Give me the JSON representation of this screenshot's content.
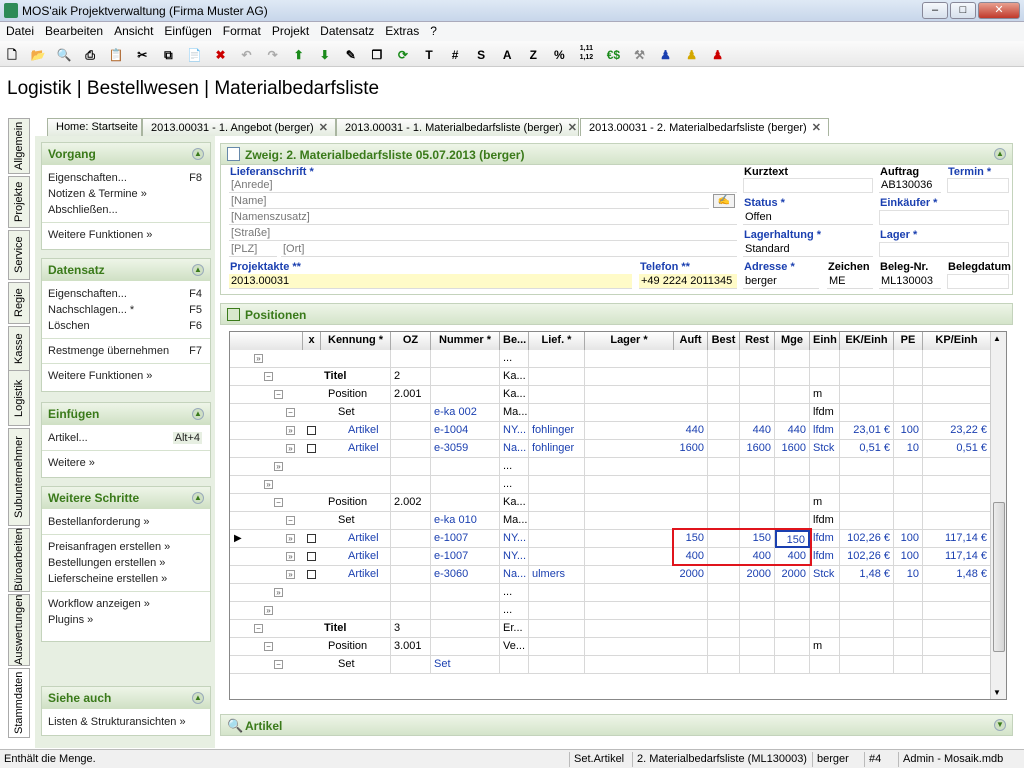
{
  "window": {
    "title": "MOS'aik Projektverwaltung (Firma Muster AG)",
    "minimize": "–",
    "maximize": "□",
    "close": "✕"
  },
  "menu": [
    "Datei",
    "Bearbeiten",
    "Ansicht",
    "Einfügen",
    "Format",
    "Projekt",
    "Datensatz",
    "Extras",
    "?"
  ],
  "toolbar": {
    "t": "T",
    "hash": "#",
    "s": "S",
    "a": "A",
    "z": "Z",
    "pct": "%",
    "num": "1,11 1,12",
    "eur": "€$"
  },
  "page_title": "Logistik | Bestellwesen | Materialbedarfsliste",
  "left_tabs": [
    "Allgemein",
    "Projekte",
    "Service",
    "Regie",
    "Kasse",
    "Logistik",
    "Subunternehmer",
    "Büroarbeiten",
    "Auswertungen",
    "Stammdaten"
  ],
  "doc_tabs": [
    {
      "label": "Home: Startseite",
      "close": ""
    },
    {
      "label": "2013.00031 - 1. Angebot (berger)",
      "close": "✕"
    },
    {
      "label": "2013.00031 - 1. Materialbedarfsliste (berger)",
      "close": "✕"
    },
    {
      "label": "2013.00031 - 2. Materialbedarfsliste (berger)",
      "close": "✕"
    }
  ],
  "side": {
    "vorgang": {
      "title": "Vorgang",
      "items": [
        {
          "label": "Eigenschaften...",
          "key": "F8"
        },
        {
          "label": "Notizen & Termine »",
          "key": ""
        },
        {
          "label": "Abschließen...",
          "key": ""
        }
      ],
      "more": "Weitere Funktionen »"
    },
    "datensatz": {
      "title": "Datensatz",
      "items": [
        {
          "label": "Eigenschaften...",
          "key": "F4"
        },
        {
          "label": "Nachschlagen... *",
          "key": "F5"
        },
        {
          "label": "Löschen",
          "key": "F6"
        }
      ],
      "extra": {
        "label": "Restmenge übernehmen",
        "key": "F7"
      },
      "more": "Weitere Funktionen »"
    },
    "einfuegen": {
      "title": "Einfügen",
      "items": [
        {
          "label": "Artikel...",
          "key": "Alt+4"
        }
      ],
      "more": "Weitere »"
    },
    "schritte": {
      "title": "Weitere Schritte",
      "items": [
        "Bestellanforderung »",
        "Preisanfragen erstellen »",
        "Bestellungen erstellen »",
        "Lieferscheine erstellen »",
        "Workflow anzeigen »",
        "Plugins »"
      ]
    },
    "siehe": {
      "title": "Siehe auch",
      "items": [
        "Listen & Strukturansichten »"
      ]
    }
  },
  "zweig_title": "Zweig: 2. Materialbedarfsliste 05.07.2013 (berger)",
  "form": {
    "lieferanschrift": "Lieferanschrift *",
    "anrede": "[Anrede]",
    "name": "[Name]",
    "namenszusatz": "[Namenszusatz]",
    "strasse": "[Straße]",
    "plz": "[PLZ]",
    "ort": "[Ort]",
    "projektakte_lbl": "Projektakte **",
    "projektakte": "2013.00031",
    "telefon_lbl": "Telefon **",
    "telefon": "+49 2224 2011345",
    "kurztext_lbl": "Kurztext",
    "kurztext": "",
    "auftrag_lbl": "Auftrag",
    "auftrag": "AB130036",
    "termin_lbl": "Termin *",
    "termin": "",
    "status_lbl": "Status *",
    "status": "Offen",
    "einkaeufer_lbl": "Einkäufer *",
    "einkaeufer": "",
    "lagerhaltung_lbl": "Lagerhaltung *",
    "lagerhaltung": "Standard",
    "lager_lbl": "Lager *",
    "lager": "",
    "adresse_lbl": "Adresse *",
    "adresse": "berger",
    "zeichen_lbl": "Zeichen",
    "zeichen": "ME",
    "belegnr_lbl": "Beleg-Nr.",
    "belegnr": "ML130003",
    "belegdatum_lbl": "Belegdatum",
    "belegdatum": ""
  },
  "positionen_title": "Positionen",
  "grid": {
    "headers": [
      "",
      "x",
      "Kennung *",
      "OZ",
      "Nummer *",
      "Be...",
      "Lief. *",
      "Lager *",
      "Auft",
      "Best",
      "Rest",
      "Mge",
      "Einh",
      "EK/Einh",
      "PE",
      "KP/Einh"
    ],
    "rows": [
      {
        "kennung": "",
        "oz": "",
        "nummer": "",
        "be": "...",
        "lief": "",
        "auft": "",
        "best": "",
        "rest": "",
        "mge": "",
        "einh": "",
        "ek": "",
        "pe": "",
        "kp": ""
      },
      {
        "kennung": "Titel",
        "oz": "2",
        "nummer": "",
        "be": "Ka...",
        "lief": "",
        "auft": "",
        "best": "",
        "rest": "",
        "mge": "",
        "einh": "",
        "ek": "",
        "pe": "",
        "kp": ""
      },
      {
        "kennung": "Position",
        "oz": "2.001",
        "nummer": "",
        "be": "Ka...",
        "lief": "",
        "auft": "",
        "best": "",
        "rest": "",
        "mge": "",
        "einh": "m",
        "ek": "",
        "pe": "",
        "kp": ""
      },
      {
        "kennung": "Set",
        "oz": "",
        "nummer": "e-ka 002",
        "be": "Ma...",
        "lief": "",
        "auft": "",
        "best": "",
        "rest": "",
        "mge": "",
        "einh": "lfdm",
        "ek": "",
        "pe": "",
        "kp": ""
      },
      {
        "kennung": "Artikel",
        "oz": "",
        "nummer": "e-1004",
        "be": "NY...",
        "lief": "fohlinger",
        "auft": "440",
        "best": "",
        "rest": "440",
        "mge": "440",
        "einh": "lfdm",
        "ek": "23,01 €",
        "pe": "100",
        "kp": "23,22 €"
      },
      {
        "kennung": "Artikel",
        "oz": "",
        "nummer": "e-3059",
        "be": "Na...",
        "lief": "fohlinger",
        "auft": "1600",
        "best": "",
        "rest": "1600",
        "mge": "1600",
        "einh": "Stck",
        "ek": "0,51 €",
        "pe": "10",
        "kp": "0,51 €"
      },
      {
        "kennung": "",
        "oz": "",
        "nummer": "",
        "be": "...",
        "lief": "",
        "auft": "",
        "best": "",
        "rest": "",
        "mge": "",
        "einh": "",
        "ek": "",
        "pe": "",
        "kp": ""
      },
      {
        "kennung": "",
        "oz": "",
        "nummer": "",
        "be": "...",
        "lief": "",
        "auft": "",
        "best": "",
        "rest": "",
        "mge": "",
        "einh": "",
        "ek": "",
        "pe": "",
        "kp": ""
      },
      {
        "kennung": "Position",
        "oz": "2.002",
        "nummer": "",
        "be": "Ka...",
        "lief": "",
        "auft": "",
        "best": "",
        "rest": "",
        "mge": "",
        "einh": "m",
        "ek": "",
        "pe": "",
        "kp": ""
      },
      {
        "kennung": "Set",
        "oz": "",
        "nummer": "e-ka 010",
        "be": "Ma...",
        "lief": "",
        "auft": "",
        "best": "",
        "rest": "",
        "mge": "",
        "einh": "lfdm",
        "ek": "",
        "pe": "",
        "kp": ""
      },
      {
        "kennung": "Artikel",
        "oz": "",
        "nummer": "e-1007",
        "be": "NY...",
        "lief": "",
        "auft": "150",
        "best": "",
        "rest": "150",
        "mge": "150",
        "einh": "lfdm",
        "ek": "102,26 €",
        "pe": "100",
        "kp": "117,14 €"
      },
      {
        "kennung": "Artikel",
        "oz": "",
        "nummer": "e-1007",
        "be": "NY...",
        "lief": "",
        "auft": "400",
        "best": "",
        "rest": "400",
        "mge": "400",
        "einh": "lfdm",
        "ek": "102,26 €",
        "pe": "100",
        "kp": "117,14 €"
      },
      {
        "kennung": "Artikel",
        "oz": "",
        "nummer": "e-3060",
        "be": "Na...",
        "lief": "ulmers",
        "auft": "2000",
        "best": "",
        "rest": "2000",
        "mge": "2000",
        "einh": "Stck",
        "ek": "1,48 €",
        "pe": "10",
        "kp": "1,48 €"
      },
      {
        "kennung": "",
        "oz": "",
        "nummer": "",
        "be": "...",
        "lief": "",
        "auft": "",
        "best": "",
        "rest": "",
        "mge": "",
        "einh": "",
        "ek": "",
        "pe": "",
        "kp": ""
      },
      {
        "kennung": "",
        "oz": "",
        "nummer": "",
        "be": "...",
        "lief": "",
        "auft": "",
        "best": "",
        "rest": "",
        "mge": "",
        "einh": "",
        "ek": "",
        "pe": "",
        "kp": ""
      },
      {
        "kennung": "Titel",
        "oz": "3",
        "nummer": "",
        "be": "Er...",
        "lief": "",
        "auft": "",
        "best": "",
        "rest": "",
        "mge": "",
        "einh": "",
        "ek": "",
        "pe": "",
        "kp": ""
      },
      {
        "kennung": "Position",
        "oz": "3.001",
        "nummer": "",
        "be": "Ve...",
        "lief": "",
        "auft": "",
        "best": "",
        "rest": "",
        "mge": "",
        "einh": "m",
        "ek": "",
        "pe": "",
        "kp": ""
      },
      {
        "kennung": "Set",
        "oz": "",
        "nummer": "Set",
        "be": "",
        "lief": "",
        "auft": "",
        "best": "",
        "rest": "",
        "mge": "",
        "einh": "",
        "ek": "",
        "pe": "",
        "kp": ""
      }
    ]
  },
  "artikel_title": "Artikel",
  "status": {
    "hint": "Enthält die Menge.",
    "ctx": "Set.Artikel",
    "doc": "2. Materialbedarfsliste (ML130003)",
    "user": "berger",
    "num": "#4",
    "db": "Admin - Mosaik.mdb"
  }
}
